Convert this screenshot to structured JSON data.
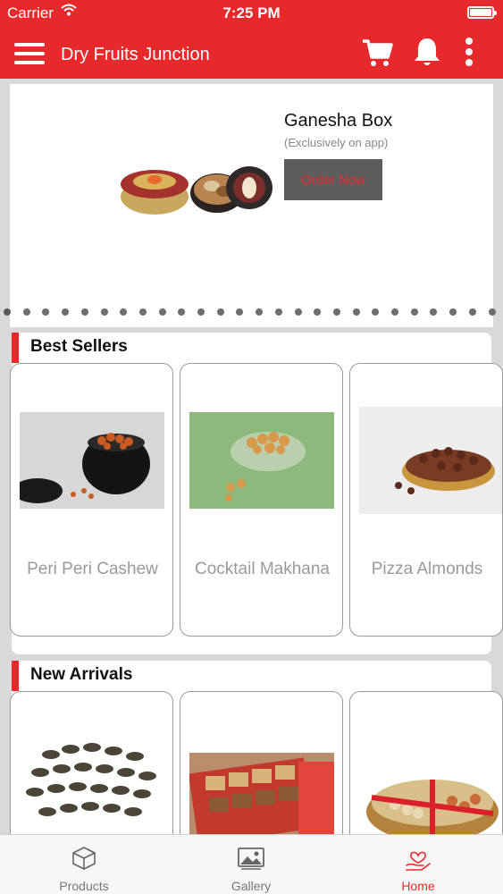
{
  "status_bar": {
    "carrier": "Carrier",
    "time": "7:25 PM"
  },
  "app_bar": {
    "title": "Dry Fruits Junction",
    "icons": [
      "menu-icon",
      "cart-icon",
      "bell-icon",
      "more-vertical-icon"
    ]
  },
  "banner": {
    "title": "Ganesha Box",
    "subtitle": "(Exclusively on app)",
    "button_label": "Order Now",
    "page_count": 26,
    "active_page": 0
  },
  "best_sellers": {
    "title": "Best Sellers",
    "items": [
      {
        "name": "Peri Peri Cashew"
      },
      {
        "name": "Cocktail Makhana"
      },
      {
        "name": "Pizza Almonds"
      }
    ]
  },
  "new_arrivals": {
    "title": "New Arrivals",
    "items": [
      {
        "name": ""
      },
      {
        "name": ""
      },
      {
        "name": ""
      }
    ]
  },
  "tab_bar": {
    "tabs": [
      {
        "label": "Products",
        "icon": "products-icon",
        "active": false
      },
      {
        "label": "Gallery",
        "icon": "gallery-icon",
        "active": false
      },
      {
        "label": "Home",
        "icon": "home-icon",
        "active": true
      }
    ]
  },
  "colors": {
    "accent": "#e8292b",
    "button_bg": "#5d5d5d",
    "muted_text": "#9a9a9a"
  }
}
